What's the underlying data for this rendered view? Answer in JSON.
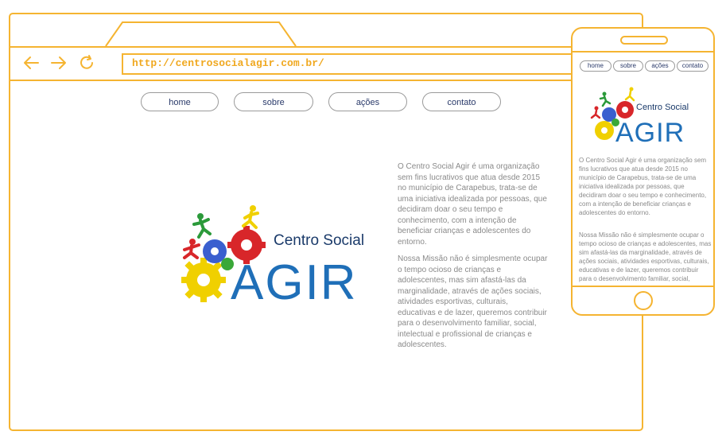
{
  "browser": {
    "url": "http://centrosocialagir.com.br/",
    "back_icon": "arrow-left-icon",
    "forward_icon": "arrow-right-icon",
    "reload_icon": "reload-icon"
  },
  "nav": {
    "home": "home",
    "sobre": "sobre",
    "acoes": "ações",
    "contato": "contato"
  },
  "logo": {
    "line1": "Centro Social",
    "line2": "AGIR"
  },
  "content": {
    "para1_lines": [
      "O Centro Social Agir é uma organização",
      "sem fins lucrativos que atua desde 2015",
      "no município de Carapebus, trata-se de",
      "uma iniciativa idealizada por pessoas, que",
      "decidiram doar o seu tempo e",
      "conhecimento, com a intenção de",
      "beneficiar crianças e adolescentes do",
      "entorno."
    ],
    "para2_lines": [
      "Nossa Missão não é simplesmente ocupar",
      "o tempo ocioso de crianças e",
      "adolescentes, mas sim afastá-las da",
      "marginalidade, através de ações sociais,",
      "atividades esportivas, culturais,",
      "educativas e de lazer, queremos contribuir",
      "para o desenvolvimento familiar, social,",
      "intelectual e profissional de crianças e",
      "adolescentes."
    ]
  },
  "mobile": {
    "para1_lines": [
      "O Centro Social Agir é uma organização sem",
      "fins lucrativos que atua desde 2015 no",
      "município de Carapebus, trata-se de uma",
      "iniciativa idealizada por pessoas, que",
      "decidiram doar o seu tempo e conhecimento,",
      "com a intenção de beneficiar crianças e",
      "adolescentes do entorno."
    ],
    "para2_lines": [
      "Nossa Missão não é simplesmente ocupar o",
      "tempo ocioso de crianças e adolescentes, mas",
      "sim afastá-las da marginalidade, através de",
      "ações sociais, atividades esportivas, culturais,",
      "educativas e de lazer, queremos contribuir",
      "para o desenvolvimento familiar, social,"
    ]
  },
  "colors": {
    "accent": "#f5b431",
    "nav_text": "#2a3a6a",
    "body_text": "#8a8a8a",
    "logo_blue": "#1f6fb8"
  }
}
